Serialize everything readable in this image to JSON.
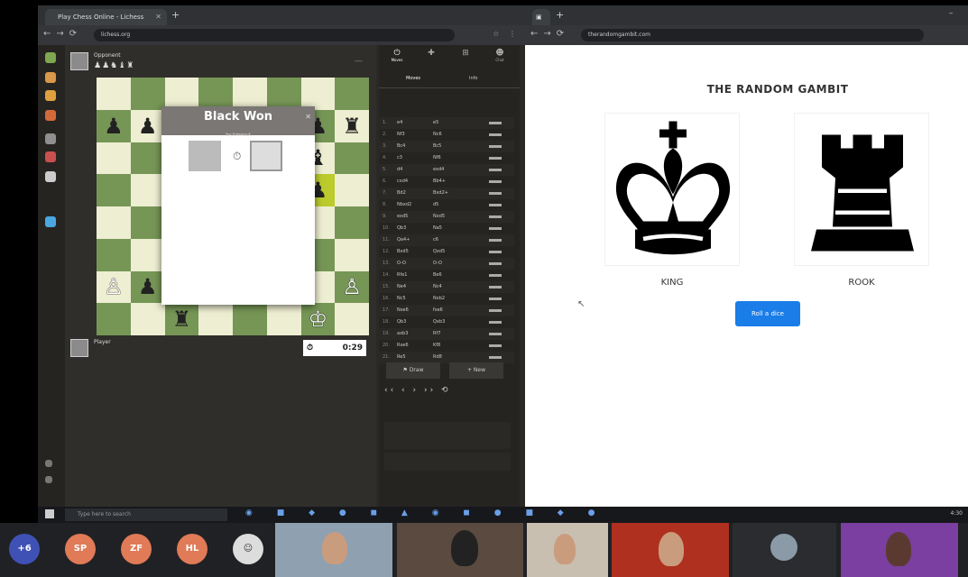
{
  "left_browser": {
    "tab_title": "Play Chess Online - Lichess",
    "url": "lichess.org",
    "top_player": {
      "name": "Opponent",
      "captured": "♟♟♞♝♜"
    },
    "bottom_player": {
      "name": "Player"
    },
    "bottom_clock": "0:29",
    "modal": {
      "title": "Black Won",
      "subtitle": "by timeout"
    },
    "panel_tabs": [
      "Moves",
      "Chat"
    ],
    "panel_subtabs": [
      "Moves",
      "Info"
    ],
    "moves": [
      {
        "n": "1.",
        "w": "e4",
        "b": "e5"
      },
      {
        "n": "2.",
        "w": "Nf3",
        "b": "Nc6"
      },
      {
        "n": "3.",
        "w": "Bc4",
        "b": "Bc5"
      },
      {
        "n": "4.",
        "w": "c3",
        "b": "Nf6"
      },
      {
        "n": "5.",
        "w": "d4",
        "b": "exd4"
      },
      {
        "n": "6.",
        "w": "cxd4",
        "b": "Bb4+"
      },
      {
        "n": "7.",
        "w": "Bd2",
        "b": "Bxd2+"
      },
      {
        "n": "8.",
        "w": "Nbxd2",
        "b": "d5"
      },
      {
        "n": "9.",
        "w": "exd5",
        "b": "Nxd5"
      },
      {
        "n": "10.",
        "w": "Qb3",
        "b": "Na5"
      },
      {
        "n": "11.",
        "w": "Qa4+",
        "b": "c6"
      },
      {
        "n": "12.",
        "w": "Bxd5",
        "b": "Qxd5"
      },
      {
        "n": "13.",
        "w": "O-O",
        "b": "O-O"
      },
      {
        "n": "14.",
        "w": "Rfe1",
        "b": "Be6"
      },
      {
        "n": "15.",
        "w": "Ne4",
        "b": "Nc4"
      },
      {
        "n": "16.",
        "w": "Nc5",
        "b": "Nxb2"
      },
      {
        "n": "17.",
        "w": "Nxe6",
        "b": "fxe6"
      },
      {
        "n": "18.",
        "w": "Qb3",
        "b": "Qxb3"
      },
      {
        "n": "19.",
        "w": "axb3",
        "b": "Rf7"
      },
      {
        "n": "20.",
        "w": "Rxe6",
        "b": "Kf8"
      },
      {
        "n": "21.",
        "w": "Re5",
        "b": "Rd8"
      }
    ],
    "panel_buttons": [
      "Draw",
      "New"
    ]
  },
  "right_browser": {
    "tab_title": "The Random Gambit",
    "url": "therandomgambit.com",
    "title": "THE RANDOM GAMBIT",
    "cards": [
      {
        "piece_icon": "king-icon",
        "label": "KING"
      },
      {
        "piece_icon": "rook-icon",
        "label": "ROOK"
      }
    ],
    "roll_button": "Roll a dice"
  },
  "taskbar": {
    "search_placeholder": "Type here to search",
    "time": "4:30"
  },
  "meeting": {
    "participants": [
      {
        "initials": "+6",
        "color": "#3f51b5"
      },
      {
        "initials": "SP",
        "color": "#e07a57"
      },
      {
        "initials": "ZF",
        "color": "#e07a57"
      },
      {
        "initials": "HL",
        "color": "#e07a57"
      }
    ]
  }
}
